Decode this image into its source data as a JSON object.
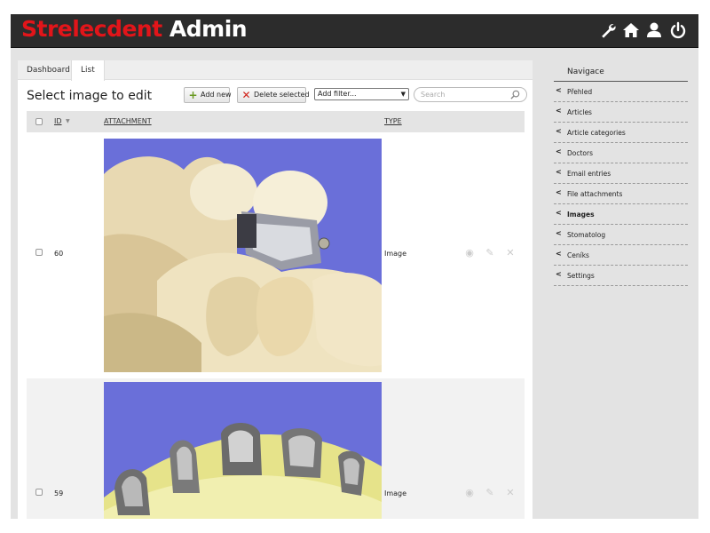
{
  "header": {
    "brand_part1": "Strelecdent",
    "brand_part2": "Admin",
    "icons": [
      "wrench-icon",
      "home-icon",
      "user-icon",
      "power-icon"
    ],
    "bg_color": "#2c2c2c",
    "brand_color": "#e2151a"
  },
  "tabs": [
    {
      "label": "Dashboard",
      "active": false
    },
    {
      "label": "List",
      "active": true
    }
  ],
  "main": {
    "title": "Select image to edit",
    "add_label": "Add new",
    "delete_label": "Delete selected",
    "filter_label": "Add filter...",
    "search_placeholder": "Search"
  },
  "table": {
    "columns": {
      "id": "ID",
      "attachment": "ATTACHMENT",
      "type": "TYPE"
    },
    "rows": [
      {
        "id": "60",
        "type": "Image"
      },
      {
        "id": "59",
        "type": "Image"
      }
    ]
  },
  "sidebar": {
    "title": "Navigace",
    "items": [
      {
        "label": "Přehled",
        "active": false
      },
      {
        "label": "Articles",
        "active": false
      },
      {
        "label": "Article categories",
        "active": false
      },
      {
        "label": "Doctors",
        "active": false
      },
      {
        "label": "Email entries",
        "active": false
      },
      {
        "label": "File attachments",
        "active": false
      },
      {
        "label": "Images",
        "active": true
      },
      {
        "label": "Stomatolog",
        "active": false
      },
      {
        "label": "Ceníks",
        "active": false
      },
      {
        "label": "Settings",
        "active": false
      }
    ]
  }
}
